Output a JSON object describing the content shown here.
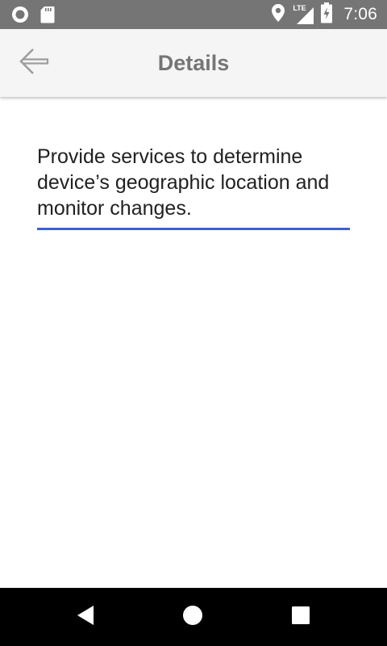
{
  "status_bar": {
    "time": "7:06",
    "network_label": "LTE",
    "left_icons": [
      "sync-circle-icon",
      "sd-card-icon"
    ],
    "right_icons": [
      "location-pin-icon",
      "lte-signal-icon",
      "battery-charging-icon"
    ]
  },
  "app_bar": {
    "title": "Details",
    "back_icon": "back-arrow-icon"
  },
  "details": {
    "text": "Provide services to determine device’s geographic location and monitor changes."
  },
  "nav_bar": {
    "buttons": [
      "back-triangle-icon",
      "home-circle-icon",
      "recents-square-icon"
    ]
  },
  "colors": {
    "status_bar": "#757575",
    "app_bar": "#f5f5f5",
    "title": "#757575",
    "underline": "#3f5fd6",
    "nav_bar": "#000000"
  }
}
